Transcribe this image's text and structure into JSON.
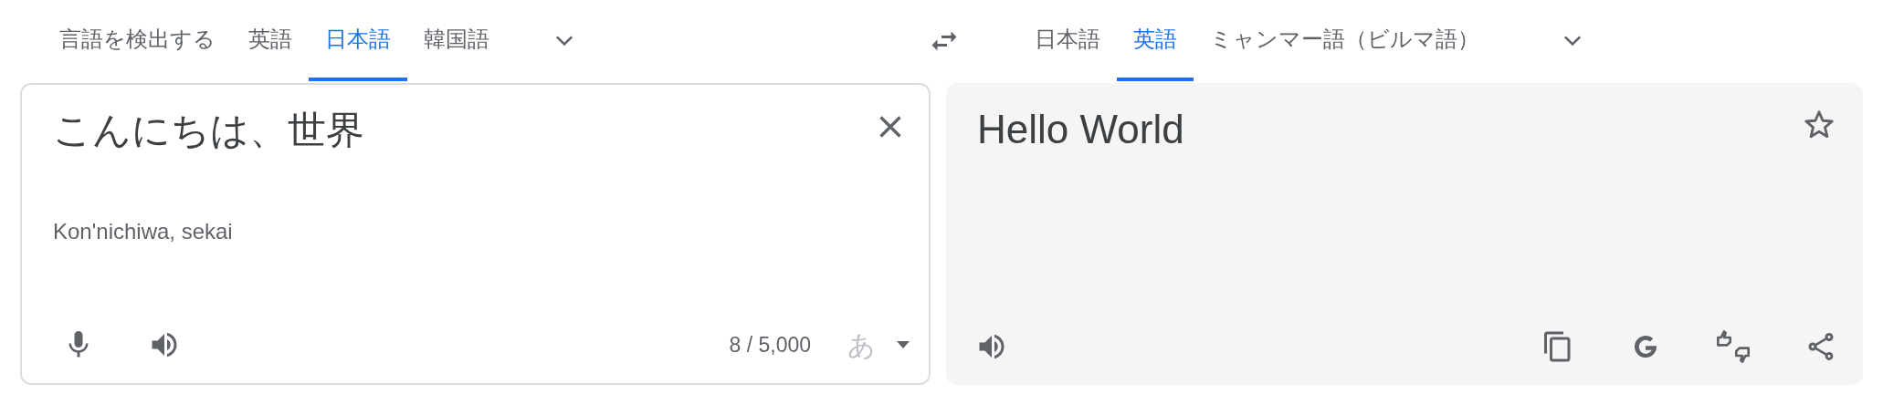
{
  "source_tabs": [
    {
      "label": "言語を検出する",
      "selected": false
    },
    {
      "label": "英語",
      "selected": false
    },
    {
      "label": "日本語",
      "selected": true
    },
    {
      "label": "韓国語",
      "selected": false
    }
  ],
  "target_tabs": [
    {
      "label": "日本語",
      "selected": false
    },
    {
      "label": "英語",
      "selected": true
    },
    {
      "label": "ミャンマー語（ビルマ語）",
      "selected": false
    }
  ],
  "source": {
    "text": "こんにちは、世界",
    "romanization": "Kon'nichiwa, sekai",
    "char_count": "8 / 5,000",
    "input_tool": "あ"
  },
  "translation": {
    "text": "Hello World"
  }
}
